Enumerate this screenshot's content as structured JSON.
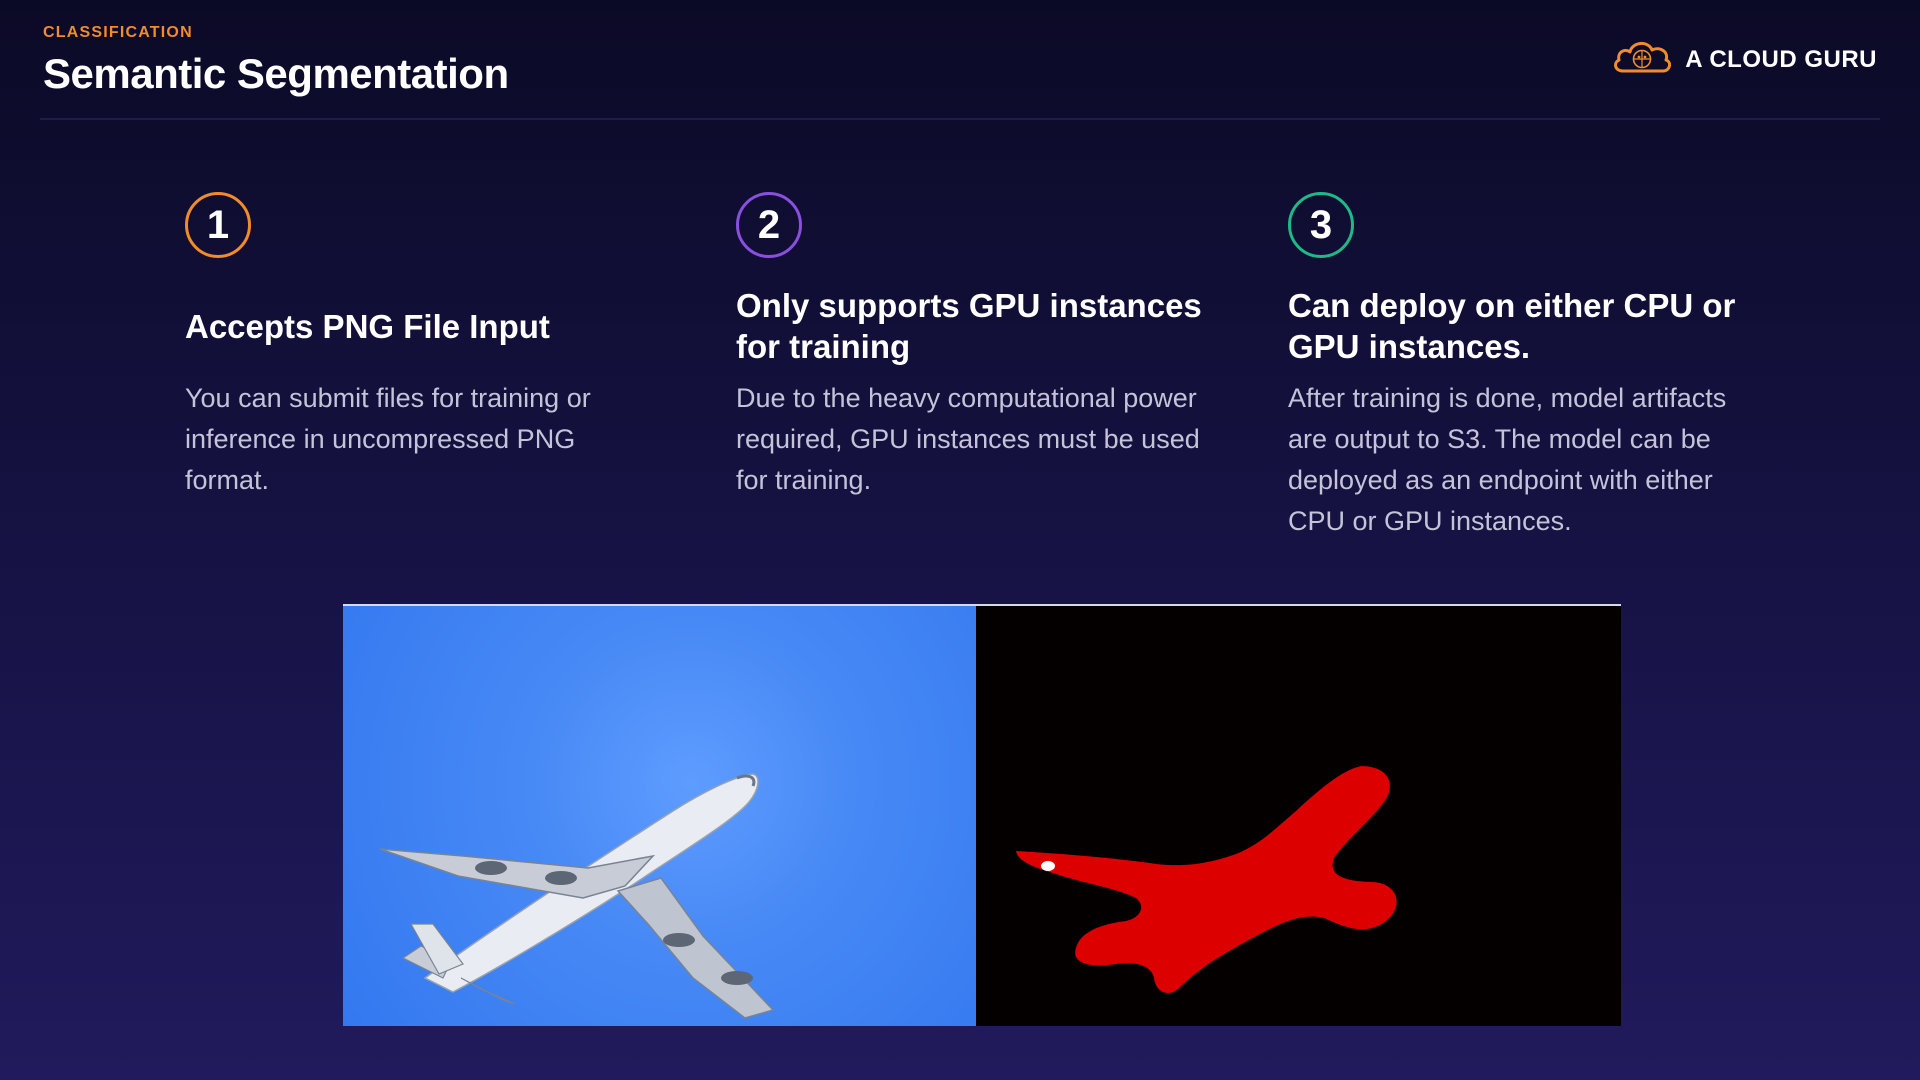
{
  "header": {
    "eyebrow": "CLASSIFICATION",
    "title": "Semantic Segmentation"
  },
  "brand": {
    "name": "A CLOUD GURU",
    "icon": "cloud-icon"
  },
  "steps": [
    {
      "number": "1",
      "heading": "Accepts PNG File Input",
      "body": "You can submit files for training or inference in uncompressed PNG format.",
      "accent": "#f28b2a"
    },
    {
      "number": "2",
      "heading": "Only supports GPU instances for training",
      "body": "Due to the heavy computational power required, GPU instances must be used for training.",
      "accent": "#8b4fe0"
    },
    {
      "number": "3",
      "heading": "Can deploy on either CPU or GPU instances.",
      "body": "After training is done, model artifacts are output to S3. The model can be deployed as an endpoint with either CPU or GPU instances.",
      "accent": "#1fb887"
    }
  ],
  "colors": {
    "background": "#171346",
    "accent_orange": "#f28b2a",
    "body_text": "#c5c3d8",
    "sky": "#4789f5",
    "mask": "#dc0000"
  }
}
